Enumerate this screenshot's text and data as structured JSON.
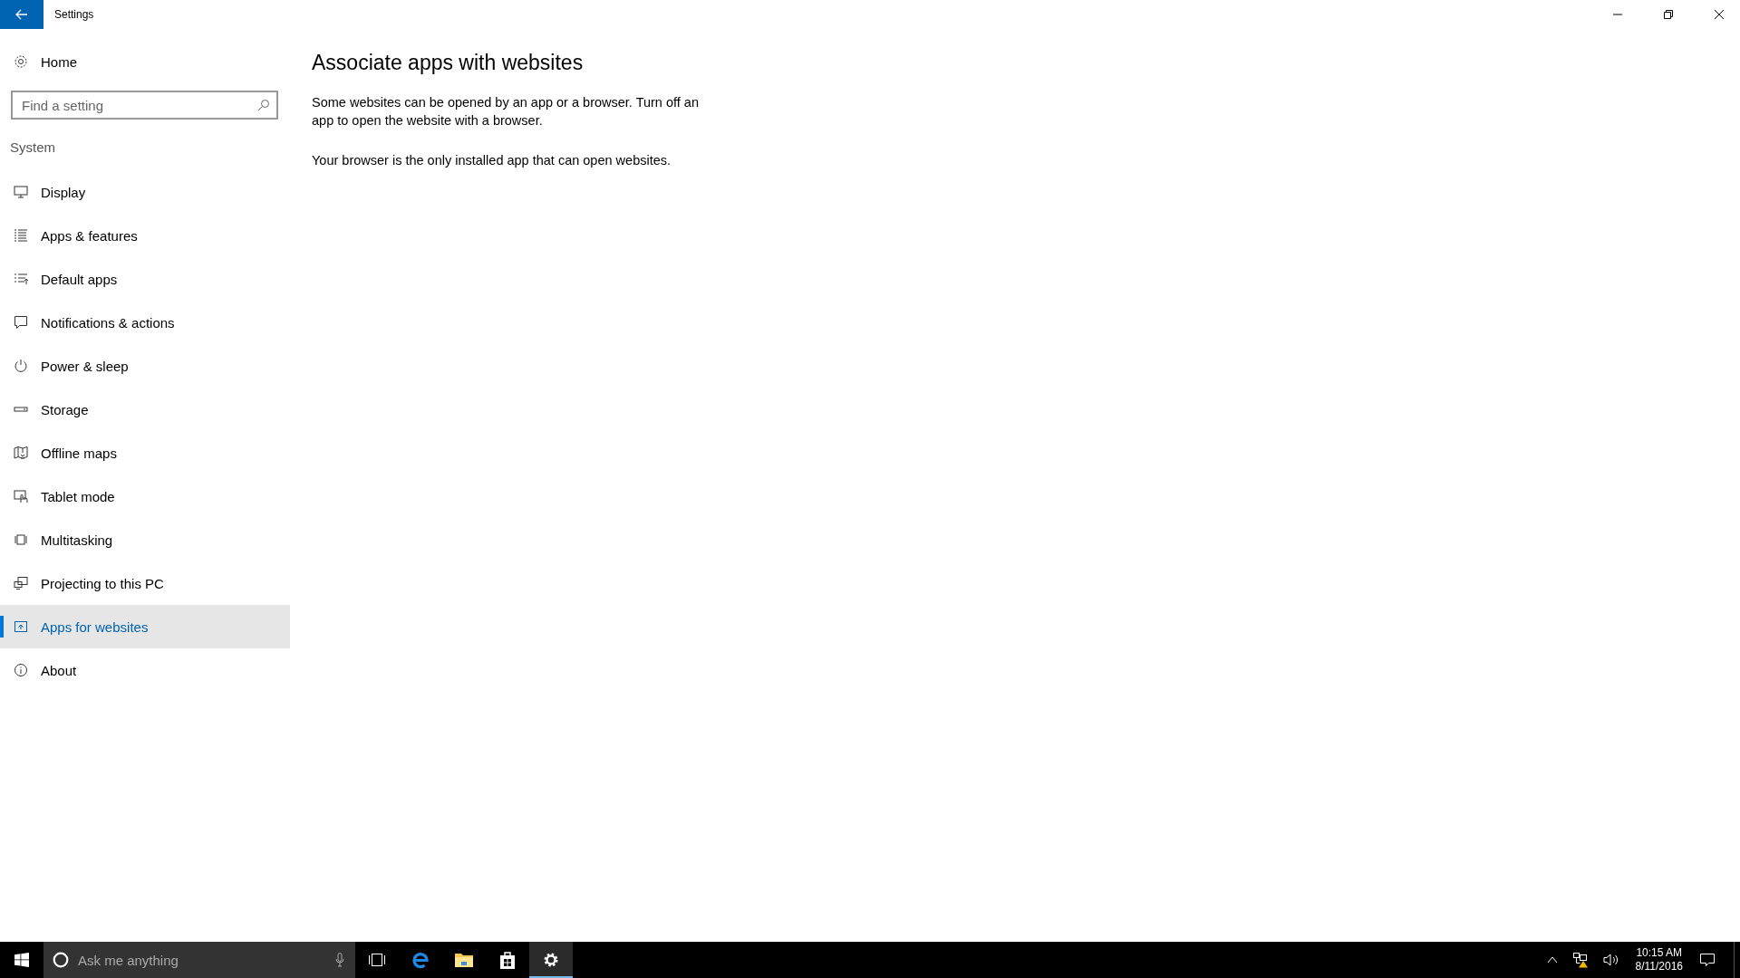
{
  "window": {
    "title": "Settings"
  },
  "sidebar": {
    "home": "Home",
    "search": {
      "placeholder": "Find a setting"
    },
    "section": "System",
    "items": [
      {
        "label": "Display",
        "selected": false
      },
      {
        "label": "Apps & features",
        "selected": false
      },
      {
        "label": "Default apps",
        "selected": false
      },
      {
        "label": "Notifications & actions",
        "selected": false
      },
      {
        "label": "Power & sleep",
        "selected": false
      },
      {
        "label": "Storage",
        "selected": false
      },
      {
        "label": "Offline maps",
        "selected": false
      },
      {
        "label": "Tablet mode",
        "selected": false
      },
      {
        "label": "Multitasking",
        "selected": false
      },
      {
        "label": "Projecting to this PC",
        "selected": false
      },
      {
        "label": "Apps for websites",
        "selected": true
      },
      {
        "label": "About",
        "selected": false
      }
    ]
  },
  "content": {
    "heading": "Associate apps with websites",
    "description": "Some websites can be opened by an app or a browser.  Turn off an app to open the website with a browser.",
    "status": "Your browser is the only installed app that can open websites."
  },
  "taskbar": {
    "search": {
      "placeholder": "Ask me anything"
    },
    "apps": [
      {
        "kind": "taskview",
        "active": false
      },
      {
        "kind": "browser",
        "active": false
      },
      {
        "kind": "explorer",
        "active": false
      },
      {
        "kind": "store",
        "active": false
      },
      {
        "kind": "settings",
        "active": true
      }
    ],
    "clock": {
      "time": "10:15 AM",
      "date": "8/11/2016"
    }
  }
}
